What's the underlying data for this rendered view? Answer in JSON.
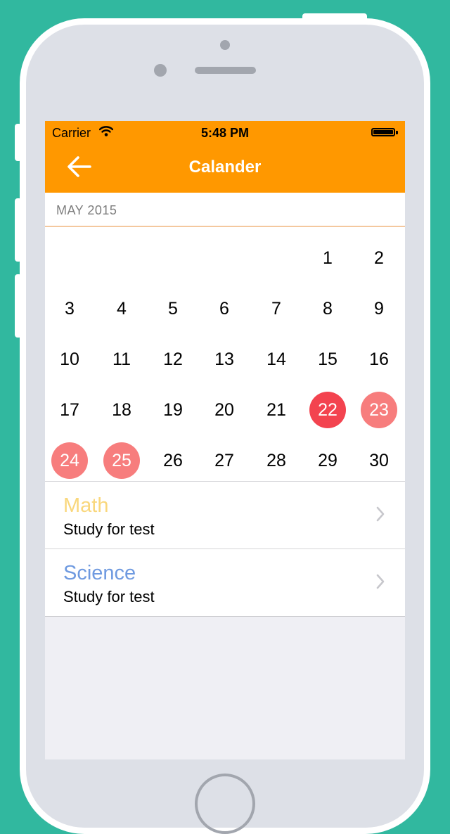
{
  "status_bar": {
    "carrier": "Carrier",
    "time": "5:48 PM",
    "wifi_icon": "wifi-icon",
    "battery_icon": "battery-icon"
  },
  "nav": {
    "title": "Calander",
    "back_icon": "arrow-left-icon",
    "color": "#ff9800"
  },
  "calendar": {
    "month_label": "MAY 2015",
    "weeks": [
      [
        "",
        "",
        "",
        "",
        "",
        "1",
        "2"
      ],
      [
        "3",
        "4",
        "5",
        "6",
        "7",
        "8",
        "9"
      ],
      [
        "10",
        "11",
        "12",
        "13",
        "14",
        "15",
        "16"
      ],
      [
        "17",
        "18",
        "19",
        "20",
        "21",
        "22",
        "23"
      ],
      [
        "24",
        "25",
        "26",
        "27",
        "28",
        "29",
        "30"
      ]
    ],
    "selected_day": "22",
    "marked_days": [
      "23",
      "24",
      "25"
    ],
    "selected_color": "#f3434f",
    "marked_color": "#f77d7d"
  },
  "events": [
    {
      "title": "Math",
      "subtitle": "Study for test",
      "title_color": "#f9d77c"
    },
    {
      "title": "Science",
      "subtitle": "Study for test",
      "title_color": "#6f9ae0"
    }
  ]
}
